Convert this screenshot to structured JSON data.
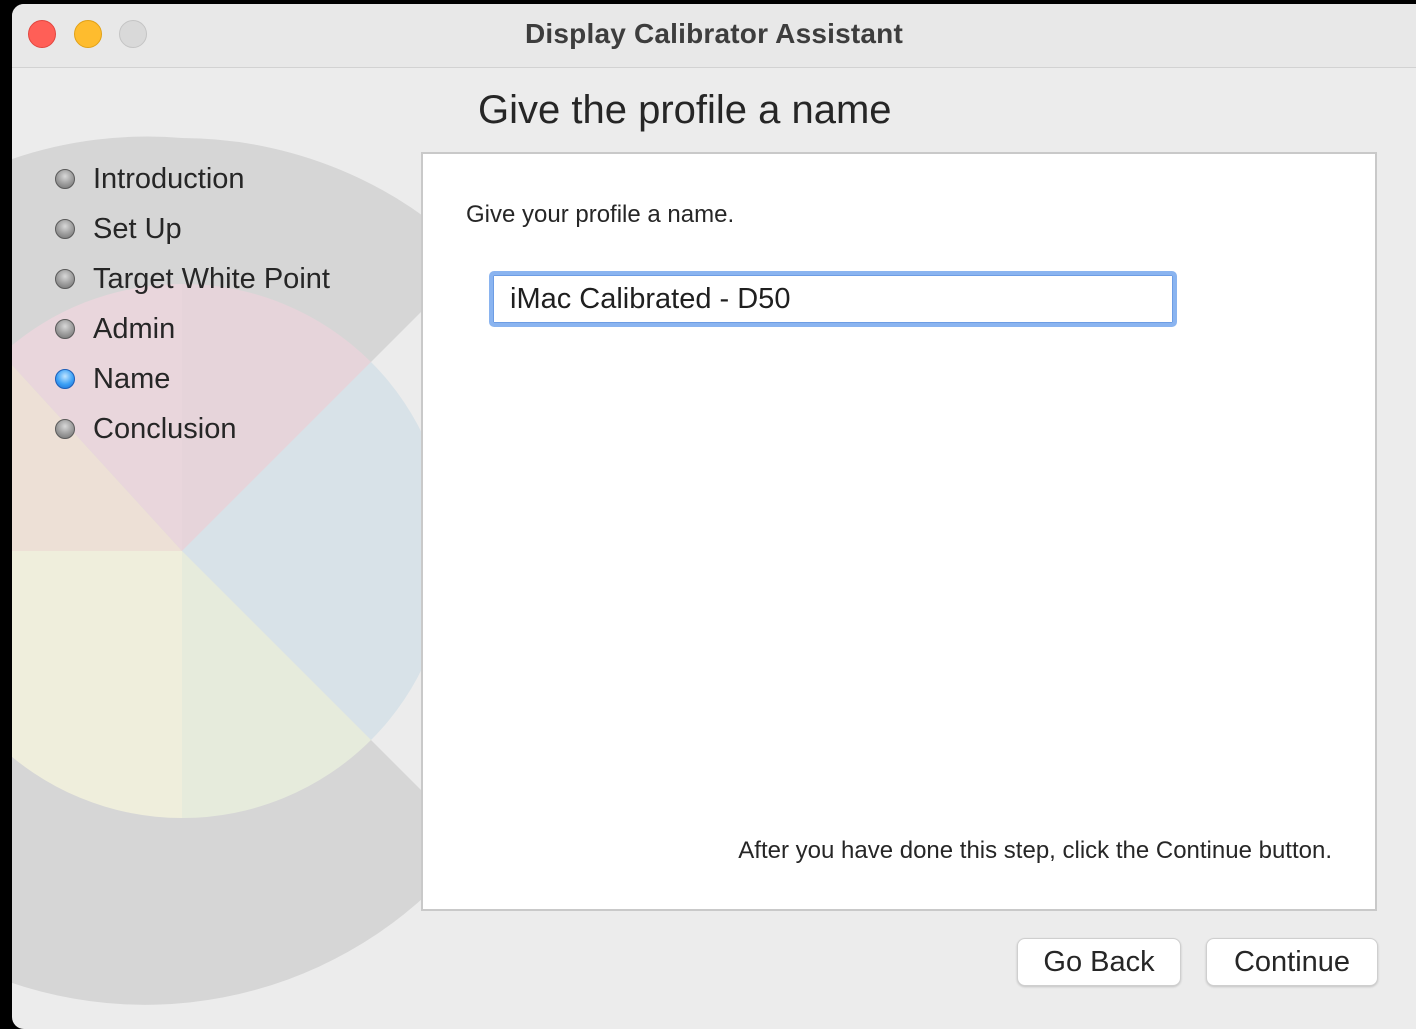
{
  "window": {
    "title": "Display Calibrator Assistant"
  },
  "page": {
    "heading": "Give the profile a name"
  },
  "steps": [
    {
      "label": "Introduction",
      "active": false
    },
    {
      "label": "Set Up",
      "active": false
    },
    {
      "label": "Target White Point",
      "active": false
    },
    {
      "label": "Admin",
      "active": false
    },
    {
      "label": "Name",
      "active": true
    },
    {
      "label": "Conclusion",
      "active": false
    }
  ],
  "content": {
    "instruction": "Give your profile a name.",
    "profile_name_value": "iMac Calibrated - D50",
    "footer_hint": "After you have done this step, click the Continue button."
  },
  "buttons": {
    "go_back": "Go Back",
    "continue": "Continue"
  },
  "colors": {
    "close": "#ff5f57",
    "minimize": "#febc2e",
    "zoom": "#d9d9d9",
    "active_step": "#3ba0f5",
    "focus_ring": "#8ab4f0"
  }
}
